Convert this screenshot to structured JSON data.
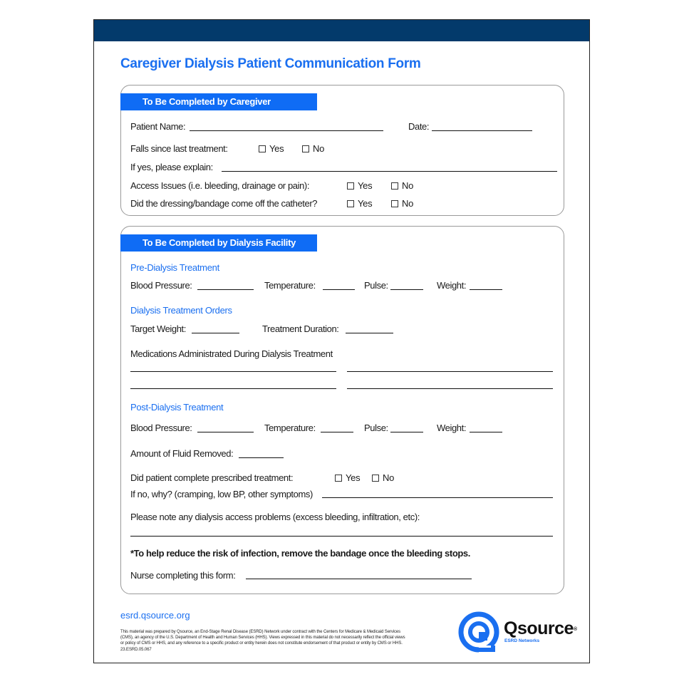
{
  "form": {
    "title": "Caregiver Dialysis Patient Communication Form",
    "caregiver_section": {
      "header": "To Be Completed by Caregiver",
      "patient_name_label": "Patient Name:",
      "date_label": "Date:",
      "falls_label": "Falls since last treatment:",
      "explain_label": "If yes, please explain:",
      "access_label": "Access Issues (i.e. bleeding, drainage or pain):",
      "dressing_label": "Did the dressing/bandage come off the catheter?",
      "yes": "Yes",
      "no": "No"
    },
    "facility_section": {
      "header": "To Be Completed by Dialysis Facility",
      "pre_heading": "Pre-Dialysis Treatment",
      "orders_heading": "Dialysis Treatment Orders",
      "post_heading": "Post-Dialysis Treatment",
      "blood_pressure_label": "Blood Pressure:",
      "temperature_label": "Temperature:",
      "pulse_label": "Pulse:",
      "weight_label": "Weight:",
      "target_weight_label": "Target Weight:",
      "treatment_duration_label": "Treatment Duration:",
      "medications_label": "Medications Administrated During Dialysis Treatment",
      "fluid_removed_label": "Amount of Fluid Removed:",
      "complete_treatment_label": "Did patient complete prescribed treatment:",
      "if_no_label": "If no, why? (cramping, low BP, other symptoms)",
      "access_problems_label": "Please note any dialysis access problems (excess bleeding, infiltration, etc):",
      "infection_note": "*To help reduce the risk of infection, remove the bandage once the bleeding stops.",
      "nurse_label": "Nurse completing this form:",
      "yes": "Yes",
      "no": "No"
    }
  },
  "footer": {
    "url": "esrd.qsource.org",
    "disclaimer": "This material was prepared by Qsource, an End-Stage Renal Disease (ESRD) Network under contract with the Centers for Medicare & Medicaid Services (CMS), an agency of the U.S. Department of Health and Human Services (HHS). Views expressed in this material do not necessarily reflect the official views or policy of CMS or HHS, and any reference to a specific product or entity herein does not constitute endorsement of that product or entity by CMS or HHS. 23.ESRD.05.067",
    "logo_name": "Qsource",
    "logo_registered": "®",
    "logo_subtitle": "ESRD Networks"
  },
  "colors": {
    "header_bar": "#033a6b",
    "accent_blue": "#0f6cf5"
  }
}
